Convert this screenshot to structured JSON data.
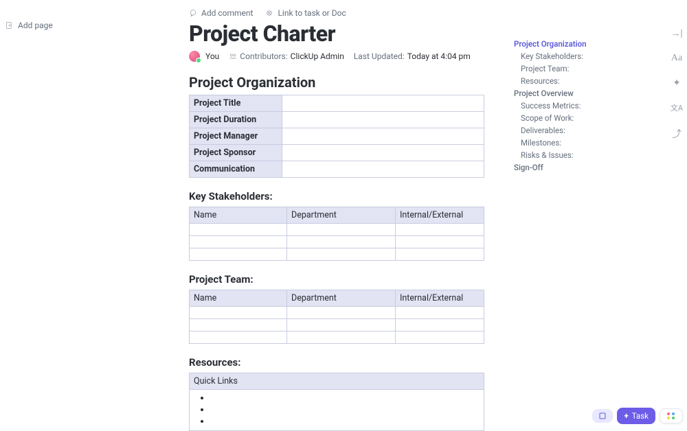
{
  "left_panel": {
    "add_page": "Add page"
  },
  "top_actions": {
    "add_comment": "Add comment",
    "link_task": "Link to task or Doc"
  },
  "title": "Project Charter",
  "meta": {
    "you": "You",
    "contributors_label": "Contributors:",
    "contributors_value": "ClickUp Admin",
    "updated_label": "Last Updated:",
    "updated_value": "Today at 4:04 pm"
  },
  "sections": {
    "org_heading": "Project Organization",
    "org_rows": [
      "Project Title",
      "Project Duration",
      "Project Manager",
      "Project Sponsor",
      "Communication"
    ],
    "stakeholders_heading": "Key Stakeholders:",
    "stake_cols": [
      "Name",
      "Department",
      "Internal/External"
    ],
    "team_heading": "Project Team:",
    "team_cols": [
      "Name",
      "Department",
      "Internal/External"
    ],
    "resources_heading": "Resources:",
    "resources_header": "Quick Links"
  },
  "outline": [
    {
      "label": "Project Organization",
      "level": 0,
      "active": true
    },
    {
      "label": "Key Stakeholders:",
      "level": 1
    },
    {
      "label": "Project Team:",
      "level": 1
    },
    {
      "label": "Resources:",
      "level": 1
    },
    {
      "label": "Project Overview",
      "level": 0
    },
    {
      "label": "Success Metrics:",
      "level": 1
    },
    {
      "label": "Scope of Work:",
      "level": 1
    },
    {
      "label": "Deliverables:",
      "level": 1
    },
    {
      "label": "Milestones:",
      "level": 1
    },
    {
      "label": "Risks & Issues:",
      "level": 1
    },
    {
      "label": "Sign-Off",
      "level": 0
    }
  ],
  "bottom": {
    "task": "Task"
  }
}
